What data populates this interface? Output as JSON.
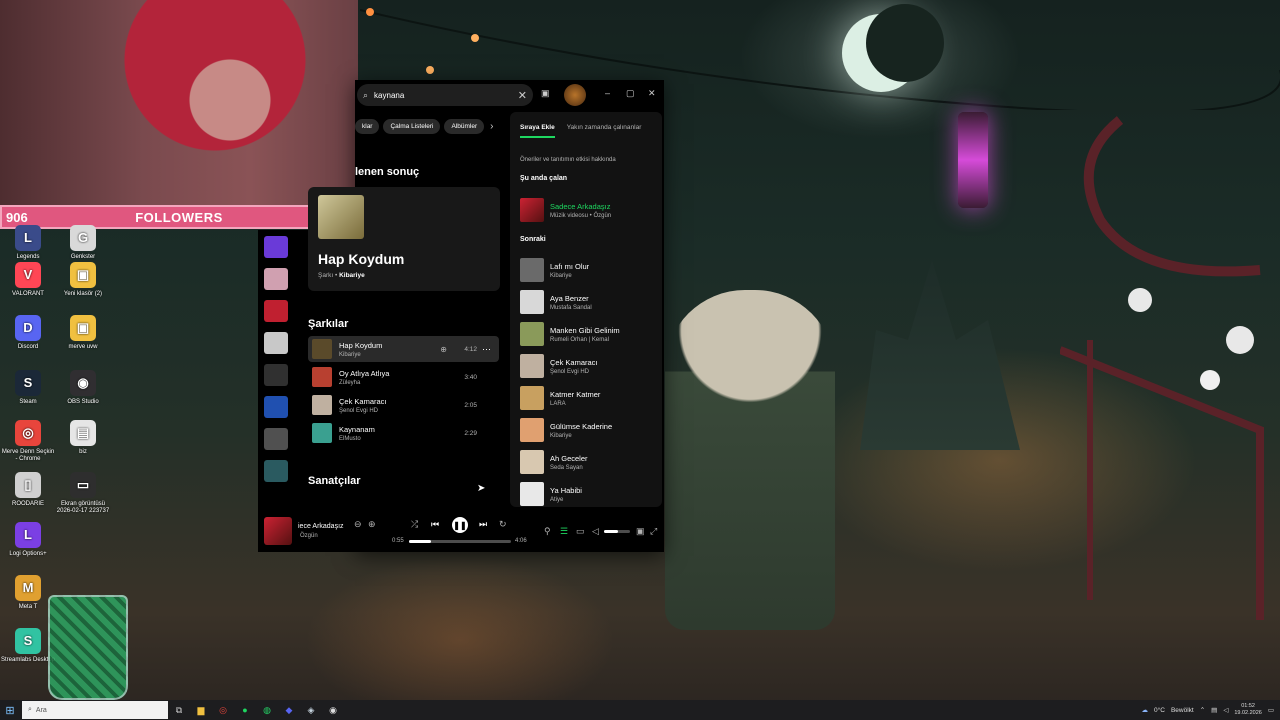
{
  "overlay": {
    "followers_count": "906",
    "followers_label": "FOLLOWERS",
    "followers_goal": "1000",
    "followers_progress_fraction": 0.906
  },
  "desktop_icons": [
    {
      "label": "Legends",
      "glyph": "L",
      "color": "#3a4b8a"
    },
    {
      "label": "Genkster",
      "glyph": "G",
      "color": "#d9d9d9"
    },
    {
      "label": "VALORANT",
      "glyph": "V",
      "color": "#ff4655"
    },
    {
      "label": "Yeni klasör (2)",
      "glyph": "▣",
      "color": "#f0c040"
    },
    {
      "label": "Discord",
      "glyph": "D",
      "color": "#5865f2"
    },
    {
      "label": "merve uvw",
      "glyph": "▣",
      "color": "#f0c040"
    },
    {
      "label": "Steam",
      "glyph": "S",
      "color": "#1b2838"
    },
    {
      "label": "OBS Studio",
      "glyph": "◉",
      "color": "#302e31"
    },
    {
      "label": "Merve Denn Seçkin - Chrome",
      "glyph": "◎",
      "color": "#e8453c"
    },
    {
      "label": "biz",
      "glyph": "▤",
      "color": "#e6e6e6"
    },
    {
      "label": "ROODARIE",
      "glyph": "▯",
      "color": "#d0d0d0"
    },
    {
      "label": "Ekran görüntüsü 2026-02-17 223737",
      "glyph": "▭",
      "color": "#2e2e2e"
    },
    {
      "label": "Logi Options+",
      "glyph": "L",
      "color": "#7b3fe4"
    },
    {
      "label": "Meta T",
      "glyph": "M",
      "color": "#e0a030"
    },
    {
      "label": "Streamlabs Desktop",
      "glyph": "S",
      "color": "#31c3a2"
    }
  ],
  "spotify": {
    "search_value": "kaynana",
    "chips": [
      "klar",
      "Çalma Listeleri",
      "Albümler"
    ],
    "top_result_heading": "lenen sonuç",
    "top_result": {
      "title": "Hap Koydum",
      "type": "Şarkı",
      "artist": "Kibariye"
    },
    "songs_heading": "Şarkılar",
    "songs": [
      {
        "title": "Hap Koydum",
        "artist": "Kibariye",
        "duration": "4:12",
        "color": "#5a4a2a"
      },
      {
        "title": "Oy Atlıya Atlıya",
        "artist": "Züleyha",
        "duration": "3:40",
        "color": "#b84030"
      },
      {
        "title": "Çek Kamaracı",
        "artist": "Şenol Evgi HD",
        "duration": "2:05",
        "color": "#bfb0a0"
      },
      {
        "title": "Kaynanam",
        "artist": "ElMusto",
        "duration": "2:29",
        "color": "#3aa090"
      }
    ],
    "artists_heading": "Sanatçılar",
    "queue": {
      "tab_active": "Sıraya Ekle",
      "tab_other": "Yakın zamanda çalınanlar",
      "note": "Öneriler ve tanıtımın etkisi hakkında",
      "now_heading": "Şu anda çalan",
      "now_playing": {
        "title": "Sadece Arkadaşız",
        "artist": "Müzik videosu • Özgün"
      },
      "next_heading": "Sonraki",
      "next": [
        {
          "title": "Lafı mı Olur",
          "artist": "Kibariye",
          "color": "#6a6a6a"
        },
        {
          "title": "Aya Benzer",
          "artist": "Mustafa Sandal",
          "color": "#d8d8d8"
        },
        {
          "title": "Manken Gibi Gelinim",
          "artist": "Rumeli Orhan | Kemal",
          "color": "#8a9a5a"
        },
        {
          "title": "Çek Kamaracı",
          "artist": "Şenol Evgi HD",
          "color": "#bfb0a0"
        },
        {
          "title": "Katmer Katmer",
          "artist": "LARA",
          "color": "#c8a060"
        },
        {
          "title": "Gülümse Kaderine",
          "artist": "Kibariye",
          "color": "#e0a070"
        },
        {
          "title": "Ah Geceler",
          "artist": "Seda Sayan",
          "color": "#d8c8b0"
        },
        {
          "title": "Ya Habibi",
          "artist": "Atiye",
          "color": "#e8e8e8"
        }
      ]
    },
    "player": {
      "title": "iece Arkadaşız",
      "artist": "Özgün",
      "elapsed": "0:55",
      "total": "4:06",
      "progress_fraction": 0.22,
      "volume_fraction": 0.55
    }
  },
  "taskbar": {
    "search_placeholder": "Ara",
    "weather": "0°C",
    "weather_status": "Bewölkt",
    "time": "01:52",
    "date": "19.02.2026"
  },
  "colors": {
    "spotify_green": "#1ed760",
    "followers_bar": "#e0577f"
  }
}
